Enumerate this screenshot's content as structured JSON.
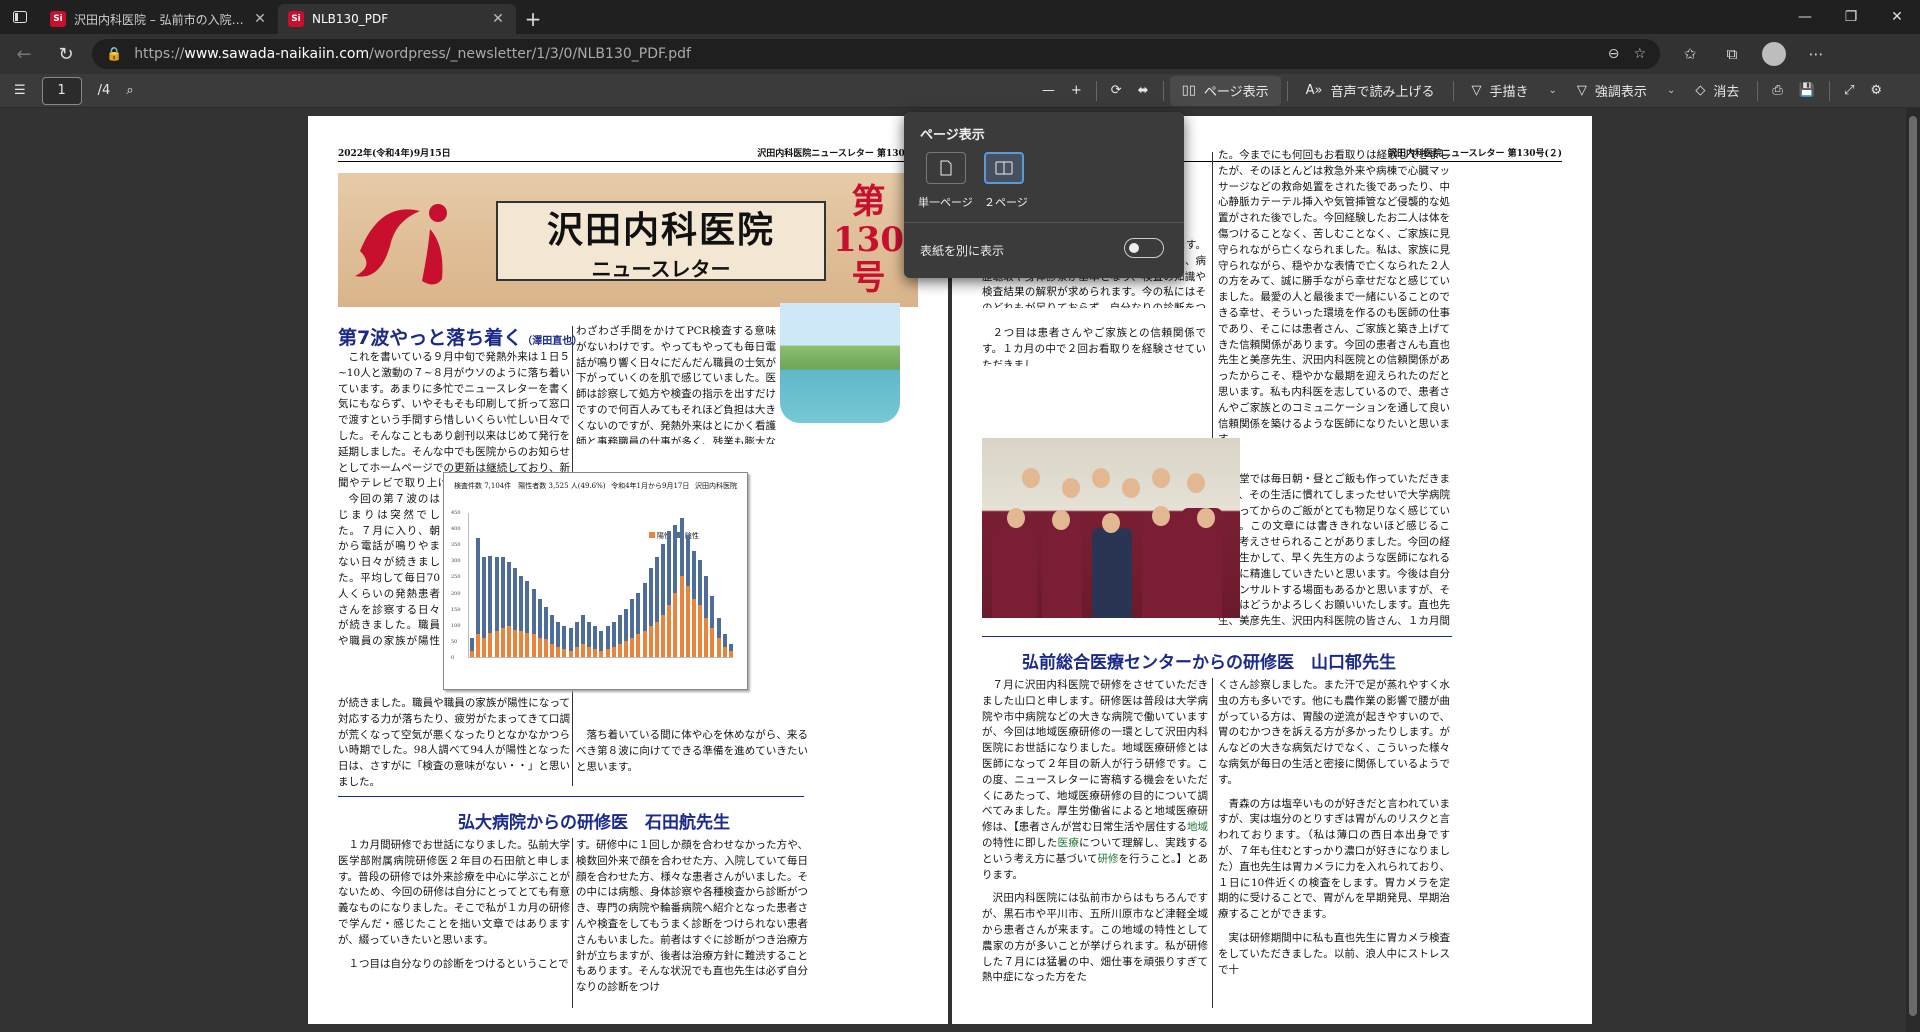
{
  "browser": {
    "tabs": [
      {
        "favicon": "Si",
        "title": "沢田内科医院 – 弘前市の入院設備"
      },
      {
        "favicon": "Si",
        "title": "NLB130_PDF"
      }
    ],
    "url_prefix": "https://",
    "url_host": "www.sawada-naikaiin.com",
    "url_path": "/wordpress/_newsletter/1/3/0/NLB130_PDF.pdf"
  },
  "pdf_toolbar": {
    "page_current": "1",
    "page_total": "/4",
    "page_view_label": "ページ表示",
    "read_aloud_label": "音声で読み上げる",
    "draw_label": "手描き",
    "highlight_label": "強調表示",
    "erase_label": "消去"
  },
  "page_view_popup": {
    "title": "ページ表示",
    "single_label": "単一ページ",
    "two_label": "２ページ",
    "cover_label": "表紙を別に表示",
    "cover_enabled": false
  },
  "page1": {
    "date": "2022年(令和4年)9月15日",
    "newsletter": "沢田内科医院ニュースレター 第130号(",
    "mast_title": "沢田内科医院",
    "mast_sub": "ニュースレター",
    "issue_l1": "第",
    "issue_l2": "130",
    "issue_l3": "号",
    "h1": "第7波やっと落ち着く",
    "h1_author": "（澤田直也）",
    "col_a": "これを書いている９月中旬で発熱外来は１日５~10人と激動の７~８月がウソのように落ち着いています。あまりに多忙でニュースレターを書く気にもならず、いやそもそも印刷して折って窓口で渡すという手間すら惜しいくらい忙しい日々でした。そんなこともあり創刊以来はじめて発行を延期しました。そんな中でも医院からのお知らせとしてホームページでの更新は継続しており、新聞やテレビで取り上げてもらうことも増えました。",
    "col_a2": "今回の第７波のはじまりは突然でした。７月に入り、朝から電話が鳴りやまない日々が続きました。平均して毎日70人くらいの発熱患者さんを診察する日々が続きました。職員や職員の家族が陽性になって対応する力が落ちたり、疲労がたまってきて口調が荒くなって空気が悪くなったりとなかなかつらい時期でした。98人調べて94人が陽性となった日は、さすがに「検査の意味がない・・」と思いました。風邪症状で受診された方はほぼコロナなわけですから、",
    "col_b": "わざわざ手間をかけてPCR検査する意味がないわけです。やってもやっても毎日電話が鳴り響く日々にだんだん職員の士気が下がっていくのを肌で感じていました。医師は診察して処方や検査の指示を出すだけですので何百人みてもそれほど負担は大きくないのですが、発熱外来はとにかく看護師と事務職員の仕事が多く、残業も膨大な時間になりました。追い打ちをかけるように解熱鎮痛剤が手に入らなくなったりと、一時は「医療崩壊」と口にせざるを得ない状況に陥りました。病院にかかりたいのにかかれない、かかっても検査ができない、薬の処方ができないとなれば医療機関としての役割を果たせなくなってしまいたわけです。",
    "col_b2": "落ち着いている間に体や心を休めながら、来るべき第８波に向けてできる準備を進めていきたいと思います。",
    "chart_cap1": "検査件数 7,104件　陽性者数 3,525 人(49.6%)",
    "chart_cap2": "令和4年1月から9月17日",
    "chart_cap3": "沢田内科医院",
    "legend_pos": "陽性",
    "legend_neg": "陰性",
    "h2": "弘大病院からの研修医　石田航先生",
    "col_c": "１カ月間研修でお世話になりました。弘前大学医学部附属病院研修医２年目の石田航と申します。普段の研修では外来診療を中心に学ぶことがないため、今回の研修は自分にとってとても有意義なものになりました。そこで私が１カ月の研修で学んだ・感じたことを拙い文章ではありますが、綴っていきたいと思います。",
    "col_c2": "１つ目は自分なりの診断をつけるということで",
    "col_d": "す。研修中に１回しか顔を合わせなかった方や、検数回外来で顔を合わせた方、入院していて毎日顔を合わせた方、様々な患者さんがいました。その中には病態、身体診察や各種検査から診断がつき、専門の病院や輪番病院へ紹介となった患者さんや検査をしてもうまく診断をつけられない患者さんもいました。前者はすぐに診断がつき治療方針が立ちますが、後者は治療方針に難渋することもあります。そんな状況でも直也先生は必ず自分なりの診断をつけ"
  },
  "page2": {
    "newsletter": "沢田内科医院ニュースレター 第130号(２)",
    "col_a": "ることで、相手から の返事も変わってきます。しかし、自分なりの診断をつけるためには、病歴聴取や身体診察が基本となり、検査の知識や検査結果の解釈が求められます。今の私にはそのどれもが足りておらず、自分なりの診断をつけるための力を研修医の内に磨いていきたいです。",
    "col_a2": "２つ目は患者さんやご家族との信頼関係です。１カ月の中で２回お看取りを経験させていただきまし",
    "col_b": "た。今までにも何回もお看取りは経験してきましたが、そのほとんどは救急外来や病棟で心臓マッサージなどの救命処置をされた後であったり、中心静脈カテーテル挿入や気管挿管など侵襲的な処置がされた後でした。今回経験したお二人は体を傷つけることなく、苦しむことなく、ご家族に見守られながら亡くなられました。私は、家族に見守られながら、穏やかな表情で亡くなられた２人の方をみて、誠に勝手ながら幸せだなと感じていました。最愛の人と最後まで一緒にいることのできる幸せ、そういった環境を作るのも医師の仕事であり、そこには患者さん、ご家族と築き上げてきた信頼関係があります。今回の患者さんも直也先生と美彦先生、沢田内科医院との信頼関係があったからこそ、穏やかな最期を迎えられたのだと思います。私も内科医を志しているので、患者さんやご家族とのコミュニケーションを通して良い信頼関係を築けるような医師になりたいと思います。",
    "col_b2": "食堂では毎日朝・昼とご飯も作っていただきまして、その生活に慣れてしまったせいで大学病院に戻ってからのご飯がとても物足りなく感じています。この文章には書ききれないほど感じること、考えさせられることがありました。今回の経験を生かして、早く先生方のような医師になれるように精進していきたいと思います。今後は自分がコンサルトする場面もあるかと思いますが、その時はどうかよろしくお願いいたします。直也先生、美彦先生、沢田内科医院の皆さん、１カ月間本当にありがとうございました。",
    "h3": "弘前総合医療センターからの研修医　山口郁先生",
    "col_c": "７月に沢田内科医院で研修をさせていただきました山口と申します。研修医は普段は大学病院や市中病院などの大きな病院で働いていますが、今回は地域医療研修の一環として沢田内科医院にお世話になりました。地域医療研修とは医師になって２年目の新人が行う研修です。この度、ニュースレターに寄稿する機会をいただくにあたって、地域医療研修の目的について調べてみました。厚生労働省によると地域医療研修は、【患者さんが営む日常生活や居住する",
    "col_c_green1": "地域",
    "col_c_mid": "の特性に即した",
    "col_c_green2": "医療",
    "col_c_mid2": "について理解し、実践するという考え方に基づいて",
    "col_c_green3": "研修",
    "col_c_end": "を行うこと。】とあります。",
    "col_c2": "沢田内科医院には弘前市からはもちろんですが、黒石市や平川市、五所川原市など津軽全域から患者さんが来ます。この地域の特性として農家の方が多いことが挙げられます。私が研修した７月には猛暑の中、畑仕事を頑張りすぎて熱中症になった方をた",
    "col_d": "くさん診察しました。また汗で足が蒸れやすく水虫の方も多いです。他にも農作業の影響で腰が曲がっている方は、胃酸の逆流が起きやすいので、胃のむかつきを訴える方が多かったりします。がんなどの大きな病気だけでなく、こういった様々な病気が毎日の生活と密接に関係しているようです。",
    "col_d2": "青森の方は塩辛いものが好きだと言われていますが、実は塩分のとりすぎは胃がんのリスクと言われております。（私は薄口の西日本出身ですが、７年も住むとすっかり濃口が好きになりました）直也先生は胃カメラに力を入れられており、１日に10件近くの検査をします。胃カメラを定期的に受けることで、胃がんを早期発見、早期治療することができます。",
    "col_d3": "実は研修期間中に私も直也先生に胃カメラ検査をしていただきました。以前、浪人中にストレスで十"
  },
  "chart_data": {
    "type": "bar",
    "title": "検査件数 7,104件　陽性者数 3,525 人(49.6%)",
    "subtitle": "令和4年1月から9月17日",
    "ylim": [
      0,
      450
    ],
    "yticks": [
      0,
      50,
      100,
      150,
      200,
      250,
      300,
      350,
      400,
      450
    ],
    "series": [
      {
        "name": "陽性",
        "color": "#e8843c",
        "values": [
          20,
          70,
          60,
          75,
          80,
          90,
          95,
          85,
          80,
          75,
          70,
          60,
          55,
          40,
          30,
          25,
          20,
          30,
          40,
          30,
          25,
          20,
          25,
          30,
          40,
          50,
          60,
          70,
          80,
          95,
          110,
          130,
          160,
          200,
          250,
          220,
          180,
          160,
          120,
          90,
          60,
          30,
          20
        ]
      },
      {
        "name": "陰性",
        "color": "#4e6e99",
        "values": [
          40,
          300,
          250,
          240,
          230,
          220,
          200,
          190,
          170,
          160,
          140,
          120,
          100,
          90,
          80,
          70,
          70,
          80,
          90,
          80,
          70,
          60,
          70,
          80,
          90,
          100,
          120,
          130,
          150,
          180,
          200,
          220,
          230,
          210,
          180,
          160,
          150,
          140,
          130,
          100,
          60,
          40,
          20
        ]
      }
    ],
    "legend": "top-right",
    "grid": false
  }
}
